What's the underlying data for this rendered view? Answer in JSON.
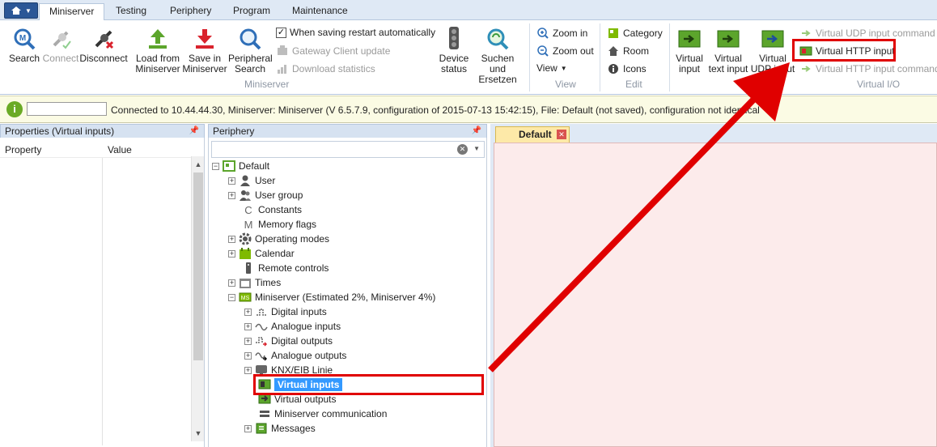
{
  "ribbon_tabs": [
    "Miniserver",
    "Testing",
    "Periphery",
    "Program",
    "Maintenance"
  ],
  "groups": {
    "miniserver": {
      "label": "Miniserver",
      "search": "Search",
      "connect": "Connect",
      "disconnect": "Disconnect",
      "load_from": "Load from Miniserver",
      "save_in": "Save in Miniserver",
      "peripheral_search": "Peripheral Search",
      "restart_check": "When saving restart automatically",
      "gateway_update": "Gateway Client update",
      "download_stats": "Download statistics",
      "device_status": "Device status",
      "suchen": "Suchen und Ersetzen"
    },
    "view": {
      "label": "View",
      "zoom_in": "Zoom in",
      "zoom_out": "Zoom out",
      "view": "View"
    },
    "edit": {
      "label": "Edit",
      "category": "Category",
      "room": "Room",
      "icons": "Icons"
    },
    "virtual_io": {
      "label": "Virtual I/O",
      "virtual_input": "Virtual input",
      "virtual_text_input": "Virtual text input",
      "virtual_udp_input": "Virtual UDP input",
      "udp_command": "Virtual UDP input command",
      "http_input": "Virtual HTTP input",
      "http_command": "Virtual HTTP input command"
    }
  },
  "status": {
    "text": "Connected to 10.44.44.30, Miniserver: Miniserver (V 6.5.7.9, configuration of 2015-07-13 15:42:15), File: Default (not saved), configuration not identical",
    "ok_glyph": "i"
  },
  "properties": {
    "title": "Properties (Virtual inputs)",
    "col_property": "Property",
    "col_value": "Value"
  },
  "periphery": {
    "title": "Periphery",
    "tree": [
      "Default",
      "User",
      "User group",
      "Constants",
      "Memory flags",
      "Operating modes",
      "Calendar",
      "Remote controls",
      "Times",
      "Miniserver (Estimated 2%, Miniserver 4%)",
      "Digital inputs",
      "Analogue inputs",
      "Digital outputs",
      "Analogue outputs",
      "KNX/EIB Linie",
      "Virtual inputs",
      "Virtual outputs",
      "Miniserver communication",
      "Messages"
    ]
  },
  "document": {
    "tab_label": "Default"
  },
  "colors": {
    "accent": "#3399ff",
    "highlight": "#e00000",
    "canvas": "#fcebeb"
  }
}
